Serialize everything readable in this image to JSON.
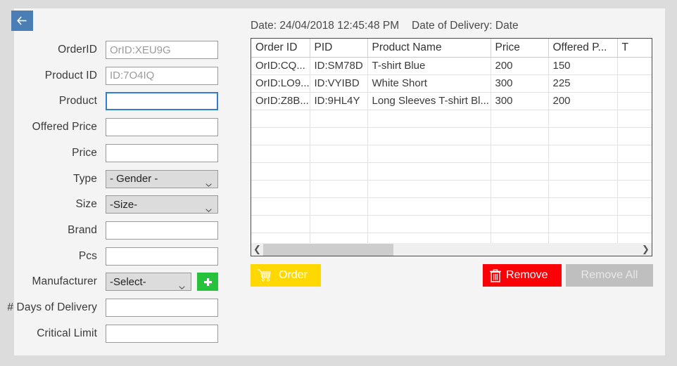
{
  "window": {
    "back_button_icon": "arrow-left-icon",
    "background_color": "#dcdcdc",
    "panel_color": "#f4f4f4"
  },
  "form": {
    "fields": [
      {
        "label": "OrderID",
        "type": "text",
        "value": "",
        "placeholder": "OrID:XEU9G",
        "focused": false
      },
      {
        "label": "Product ID",
        "type": "text",
        "value": "",
        "placeholder": "ID:7O4IQ",
        "focused": false
      },
      {
        "label": "Product",
        "type": "text",
        "value": "",
        "placeholder": "",
        "focused": true
      },
      {
        "label": "Offered Price",
        "type": "text",
        "value": "",
        "placeholder": "",
        "focused": false
      },
      {
        "label": "Price",
        "type": "text",
        "value": "",
        "placeholder": "",
        "focused": false
      },
      {
        "label": "Type",
        "type": "select",
        "value": "- Gender -",
        "placeholder": "",
        "focused": false
      },
      {
        "label": "Size",
        "type": "select",
        "value": "-Size-",
        "placeholder": "",
        "focused": false
      },
      {
        "label": "Brand",
        "type": "text",
        "value": "",
        "placeholder": "",
        "focused": false
      },
      {
        "label": "Pcs",
        "type": "text",
        "value": "",
        "placeholder": "",
        "focused": false
      },
      {
        "label": "Manufacturer",
        "type": "select-add",
        "value": "-Select-",
        "placeholder": "",
        "focused": false
      },
      {
        "label": "# Days of Delivery",
        "type": "text",
        "value": "",
        "placeholder": "",
        "focused": false
      },
      {
        "label": "Critical Limit",
        "type": "text",
        "value": "",
        "placeholder": "",
        "focused": false
      }
    ],
    "add_manufacturer_icon": "plus-icon",
    "add_manufacturer_color": "#27c23c"
  },
  "header": {
    "date_text": "Date: 24/04/2018 12:45:48 PM",
    "delivery_text": "Date of Delivery:  Date"
  },
  "grid": {
    "columns": [
      "Order ID",
      "PID",
      "Product Name",
      "Price",
      "Offered P...",
      "T"
    ],
    "rows": [
      {
        "order_id": "OrID:CQ...",
        "pid": "ID:SM78D",
        "product_name": "T-shirt Blue",
        "price": "200",
        "offered_price": "150",
        "type": ""
      },
      {
        "order_id": "OrID:LO9...",
        "pid": "ID:VYIBD",
        "product_name": "White Short",
        "price": "300",
        "offered_price": "225",
        "type": ""
      },
      {
        "order_id": "OrID:Z8B...",
        "pid": "ID:9HL4Y",
        "product_name": "Long Sleeves T-shirt Bl...",
        "price": "300",
        "offered_price": "200",
        "type": ""
      }
    ],
    "empty_row_count": 9,
    "scrollbar": {
      "left_arrow": "chevron-left-icon",
      "right_arrow": "chevron-right-icon"
    }
  },
  "actions": {
    "order": {
      "label": "Order",
      "icon": "shopping-cart-icon",
      "color": "#ffd800",
      "enabled": true
    },
    "remove": {
      "label": "Remove",
      "icon": "trash-icon",
      "color": "#fb0007",
      "enabled": true
    },
    "remove_all": {
      "label": "Remove All",
      "icon": "",
      "color": "#bfbfbf",
      "enabled": false
    }
  }
}
